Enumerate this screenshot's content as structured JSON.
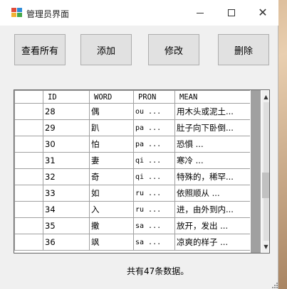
{
  "window": {
    "title": "管理员界面",
    "controls": {
      "minimize": "minimize-icon",
      "maximize": "maximize-icon",
      "close": "✕"
    }
  },
  "toolbar": {
    "view_all_label": "查看所有",
    "add_label": "添加",
    "edit_label": "修改",
    "delete_label": "删除"
  },
  "table": {
    "columns": [
      "",
      "ID",
      "WORD",
      "PRON",
      "MEAN"
    ],
    "rows": [
      {
        "id": "28",
        "word": "偶",
        "pron": "ou   ...",
        "mean": "用木头或泥土..."
      },
      {
        "id": "29",
        "word": "趴",
        "pron": "pa   ...",
        "mean": "肚子向下卧倒..."
      },
      {
        "id": "30",
        "word": "怕",
        "pron": "pa   ...",
        "mean": "恐惧        ..."
      },
      {
        "id": "31",
        "word": "妻",
        "pron": "qi   ...",
        "mean": "寒冷        ..."
      },
      {
        "id": "32",
        "word": "奇",
        "pron": "qi   ...",
        "mean": "特殊的，稀罕..."
      },
      {
        "id": "33",
        "word": "如",
        "pron": "ru   ...",
        "mean": "依照顺从    ..."
      },
      {
        "id": "34",
        "word": "入",
        "pron": "ru   ...",
        "mean": "进，由外到内..."
      },
      {
        "id": "35",
        "word": "撒",
        "pron": "sa   ...",
        "mean": "放开，发出  ..."
      },
      {
        "id": "36",
        "word": "飒",
        "pron": "sa   ...",
        "mean": "凉爽的样子  ..."
      }
    ],
    "scroll_position": 0.62
  },
  "status": {
    "text": "共有47条数据。"
  },
  "colors": {
    "window_bg": "#f0f0f0",
    "button_bg": "#e1e1e1",
    "grid_border": "#646464"
  }
}
